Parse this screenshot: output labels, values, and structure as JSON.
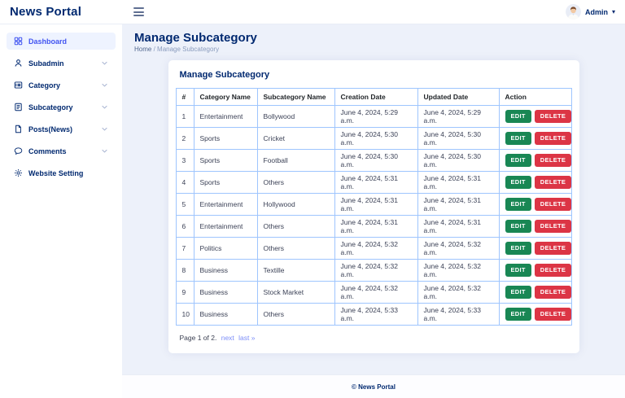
{
  "header": {
    "brand": "News Portal",
    "user": {
      "name": "Admin"
    }
  },
  "sidebar": {
    "items": [
      {
        "label": "Dashboard",
        "icon": "grid-icon",
        "active": true,
        "has_submenu": false
      },
      {
        "label": "Subadmin",
        "icon": "person-icon",
        "active": false,
        "has_submenu": true
      },
      {
        "label": "Category",
        "icon": "card-list-icon",
        "active": false,
        "has_submenu": true
      },
      {
        "label": "Subcategory",
        "icon": "journal-icon",
        "active": false,
        "has_submenu": true
      },
      {
        "label": "Posts(News)",
        "icon": "file-icon",
        "active": false,
        "has_submenu": true
      },
      {
        "label": "Comments",
        "icon": "chat-icon",
        "active": false,
        "has_submenu": true
      },
      {
        "label": "Website Setting",
        "icon": "gear-icon",
        "active": false,
        "has_submenu": false
      }
    ]
  },
  "page": {
    "title": "Manage Subcategory",
    "breadcrumb": {
      "home": "Home",
      "separator": "/",
      "current": "Manage Subcategory"
    }
  },
  "card": {
    "title": "Manage Subcategory"
  },
  "table": {
    "headers": [
      "#",
      "Category Name",
      "Subcategory Name",
      "Creation Date",
      "Updated Date",
      "Action"
    ],
    "edit_label": "EDIT",
    "delete_label": "DELETE",
    "rows": [
      {
        "num": "1",
        "category": "Entertainment",
        "subcategory": "Bollywood",
        "created": "June 4, 2024, 5:29 a.m.",
        "updated": "June 4, 2024, 5:29 a.m."
      },
      {
        "num": "2",
        "category": "Sports",
        "subcategory": "Cricket",
        "created": "June 4, 2024, 5:30 a.m.",
        "updated": "June 4, 2024, 5:30 a.m."
      },
      {
        "num": "3",
        "category": "Sports",
        "subcategory": "Football",
        "created": "June 4, 2024, 5:30 a.m.",
        "updated": "June 4, 2024, 5:30 a.m."
      },
      {
        "num": "4",
        "category": "Sports",
        "subcategory": "Others",
        "created": "June 4, 2024, 5:31 a.m.",
        "updated": "June 4, 2024, 5:31 a.m."
      },
      {
        "num": "5",
        "category": "Entertainment",
        "subcategory": "Hollywood",
        "created": "June 4, 2024, 5:31 a.m.",
        "updated": "June 4, 2024, 5:31 a.m."
      },
      {
        "num": "6",
        "category": "Entertainment",
        "subcategory": "Others",
        "created": "June 4, 2024, 5:31 a.m.",
        "updated": "June 4, 2024, 5:31 a.m."
      },
      {
        "num": "7",
        "category": "Politics",
        "subcategory": "Others",
        "created": "June 4, 2024, 5:32 a.m.",
        "updated": "June 4, 2024, 5:32 a.m."
      },
      {
        "num": "8",
        "category": "Business",
        "subcategory": "Textille",
        "created": "June 4, 2024, 5:32 a.m.",
        "updated": "June 4, 2024, 5:32 a.m."
      },
      {
        "num": "9",
        "category": "Business",
        "subcategory": "Stock Market",
        "created": "June 4, 2024, 5:32 a.m.",
        "updated": "June 4, 2024, 5:32 a.m."
      },
      {
        "num": "10",
        "category": "Business",
        "subcategory": "Others",
        "created": "June 4, 2024, 5:33 a.m.",
        "updated": "June 4, 2024, 5:33 a.m."
      }
    ]
  },
  "pagination": {
    "status": "Page 1 of 2.",
    "next": "next",
    "last": "last »"
  },
  "footer": {
    "copyright": "© News Portal"
  },
  "colors": {
    "accent": "#4154f1",
    "heading": "#012970",
    "success": "#198754",
    "danger": "#dc3545",
    "table_border": "#9ec5fe",
    "content_bg": "#edf1fa"
  }
}
